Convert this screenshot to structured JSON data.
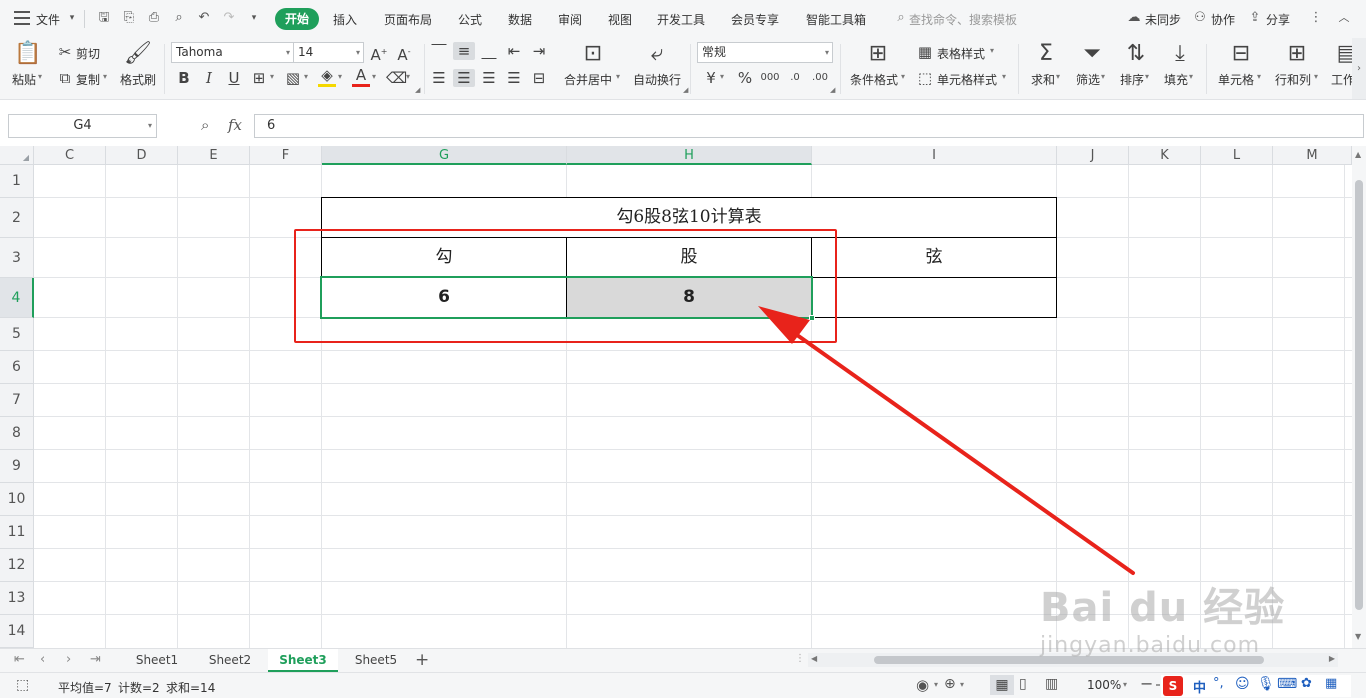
{
  "menu": {
    "file": "文件",
    "tabs": [
      "开始",
      "插入",
      "页面布局",
      "公式",
      "数据",
      "审阅",
      "视图",
      "开发工具",
      "会员专享",
      "智能工具箱"
    ],
    "search": "查找命令、搜索模板",
    "sync": "未同步",
    "collab": "协作",
    "share": "分享"
  },
  "ribbon": {
    "paste": "粘贴",
    "cut": "剪切",
    "copy": "复制",
    "format_painter": "格式刷",
    "font_name": "Tahoma",
    "font_size": "14",
    "merge_center": "合并居中",
    "wrap_text": "自动换行",
    "number_format": "常规",
    "conditional_format": "条件格式",
    "table_style": "表格样式",
    "cell_style": "单元格样式",
    "sum": "求和",
    "filter": "筛选",
    "sort": "排序",
    "fill": "填充",
    "cell": "单元格",
    "row_col": "行和列",
    "worksheet": "工作"
  },
  "formula_bar": {
    "name_box": "G4",
    "fx": "fx",
    "content": "6"
  },
  "columns": [
    "C",
    "D",
    "E",
    "F",
    "G",
    "H",
    "I",
    "J",
    "K",
    "L",
    "M"
  ],
  "rows": [
    "1",
    "2",
    "3",
    "4",
    "5",
    "6",
    "7",
    "8",
    "9",
    "10",
    "11",
    "12",
    "13",
    "14"
  ],
  "table": {
    "title": "勾6股8弦10计算表",
    "headers": [
      "勾",
      "股",
      "弦"
    ],
    "values": [
      "6",
      "8",
      ""
    ]
  },
  "sheets": [
    "Sheet1",
    "Sheet2",
    "Sheet3",
    "Sheet5"
  ],
  "active_sheet": "Sheet3",
  "status": {
    "average": "平均值=7",
    "count": "计数=2",
    "sum": "求和=14",
    "zoom": "100%",
    "ime": "中"
  },
  "watermark": {
    "logo": "Bai du 经验",
    "url": "jingyan.baidu.com"
  },
  "colors": {
    "accent": "#1f9f5b",
    "annotation": "#e8231b",
    "selected_fill": "#d9d9d9"
  }
}
